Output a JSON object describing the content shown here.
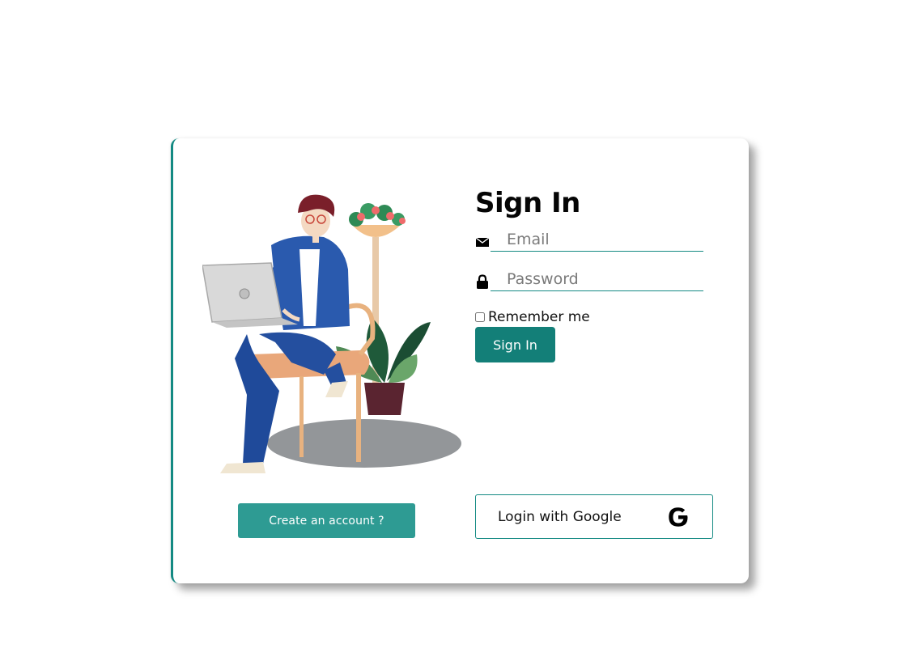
{
  "card": {
    "create_account_label": "Create an account ?",
    "illustration_icon": "person-with-laptop-illustration"
  },
  "signin": {
    "title": "Sign In",
    "email": {
      "placeholder": "Email",
      "value": "",
      "icon": "envelope-icon"
    },
    "password": {
      "placeholder": "Password",
      "value": "",
      "icon": "lock-icon"
    },
    "remember_label": "Remember me",
    "submit_label": "Sign In",
    "google_label": "Login with Google",
    "google_icon": "google-icon"
  },
  "colors": {
    "accent": "#148a83",
    "signin_button": "#137f78",
    "create_button": "#2e9b93"
  }
}
